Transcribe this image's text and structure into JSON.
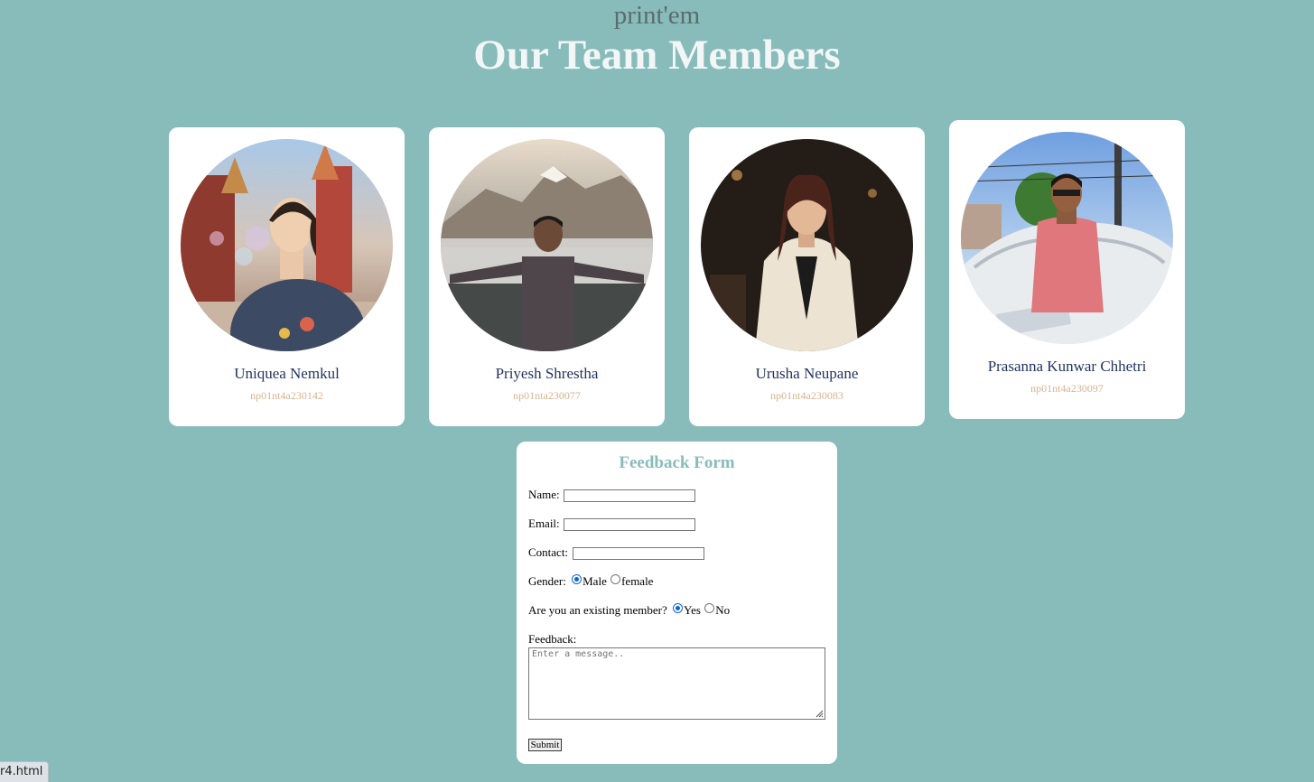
{
  "header": {
    "brand": "print'em",
    "title": "Our Team Members"
  },
  "team": [
    {
      "name": "Uniquea Nemkul",
      "id": "np01nt4a230142"
    },
    {
      "name": "Priyesh Shrestha",
      "id": "np01nta230077"
    },
    {
      "name": "Urusha Neupane",
      "id": "np01nt4a230083"
    },
    {
      "name": "Prasanna Kunwar Chhetri",
      "id": "np01nt4a230097"
    }
  ],
  "form": {
    "title": "Feedback Form",
    "name_label": "Name:",
    "name_value": "",
    "email_label": "Email:",
    "email_value": "",
    "contact_label": "Contact:",
    "contact_value": "",
    "gender_label": "Gender:",
    "gender_options": [
      "Male",
      "female"
    ],
    "gender_selected": "Male",
    "member_label": "Are you an existing member?",
    "member_options": [
      "Yes",
      "No"
    ],
    "member_selected": "Yes",
    "feedback_label": "Feedback:",
    "feedback_placeholder": "Enter a message..",
    "submit_label": "Submit"
  },
  "status_bar": {
    "text": "r4.html"
  },
  "colors": {
    "background": "#88bcbb",
    "card": "#ffffff",
    "name_text": "#223560",
    "id_text": "#d8b291",
    "form_title": "#88bcbb",
    "radio_checked": "#0a63d6"
  },
  "icons": [
    "photo-avatar",
    "resize-grip-icon"
  ]
}
